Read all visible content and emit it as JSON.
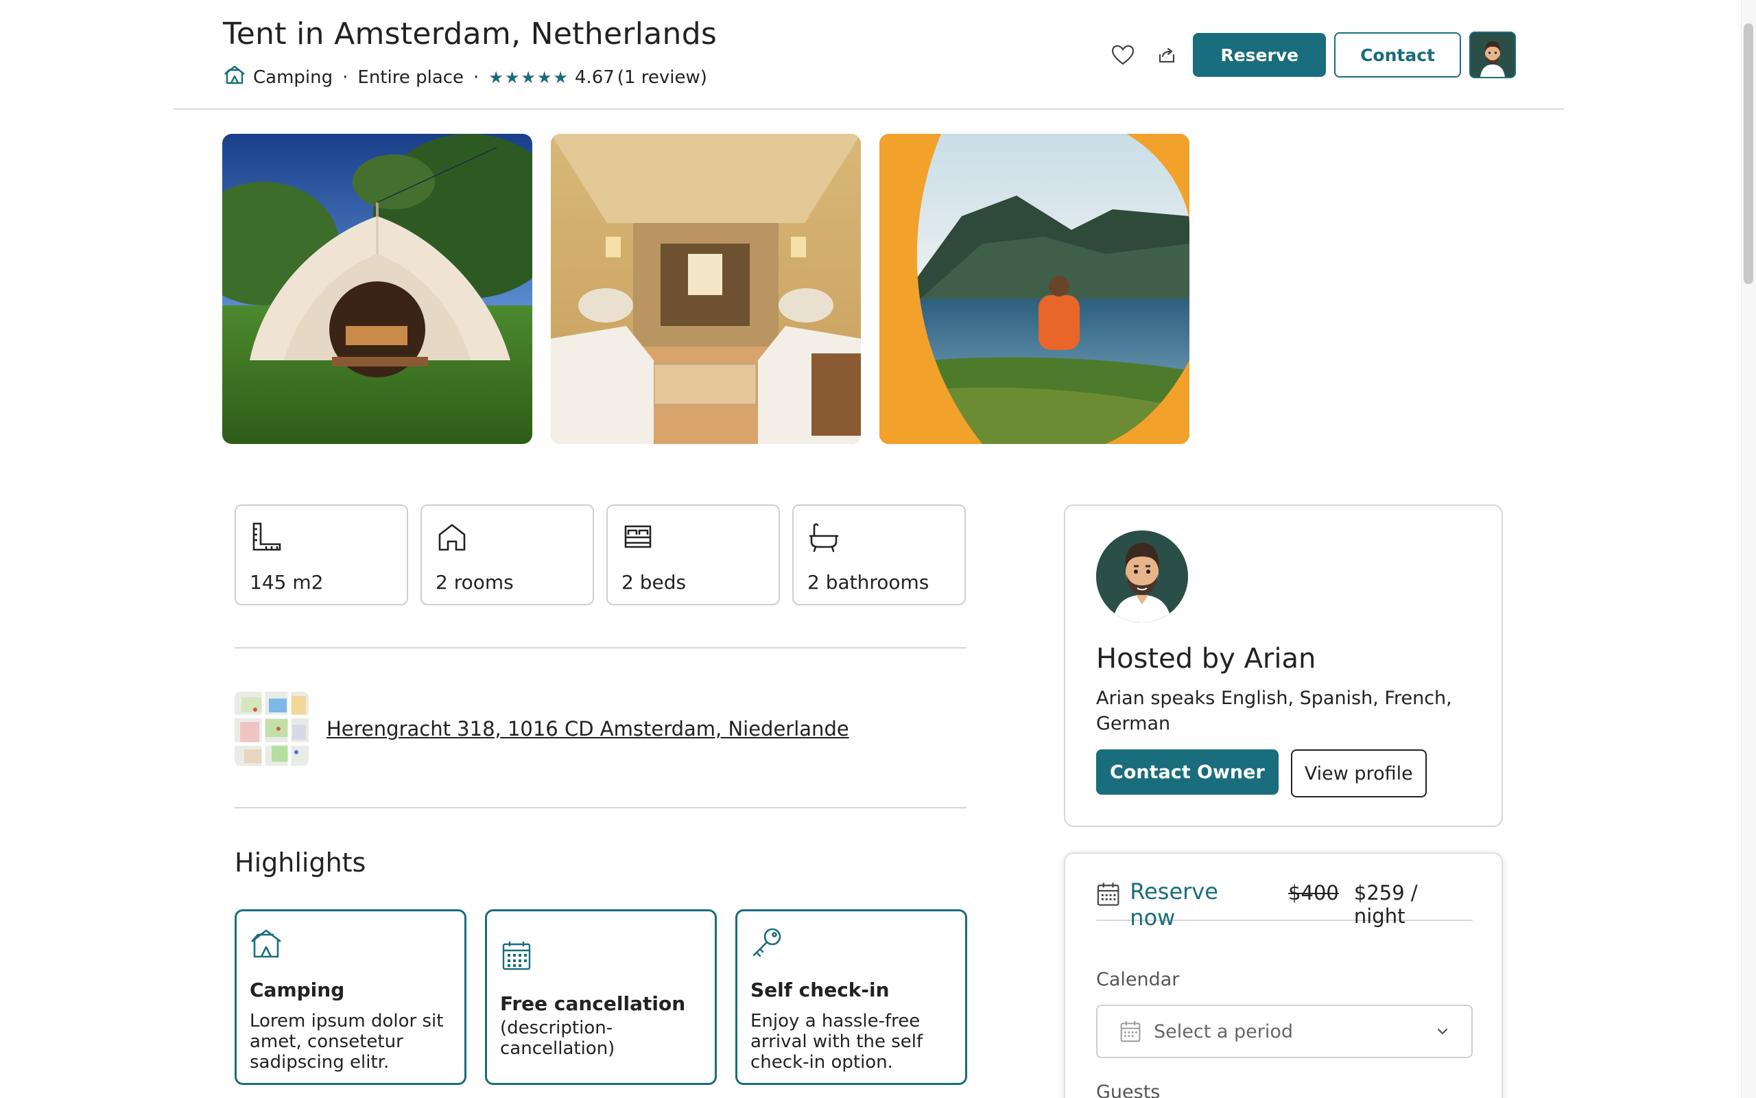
{
  "header": {
    "title": "Tent in Amsterdam, Netherlands",
    "category": "Camping",
    "type": "Entire place",
    "rating": "4.67",
    "reviews": "(1 review)",
    "reserve_label": "Reserve",
    "contact_label": "Contact"
  },
  "gallery": {
    "photos": [
      "tent-exterior",
      "tent-interior",
      "lake-view"
    ]
  },
  "stats": [
    {
      "icon": "ruler-icon",
      "label": "145 m2"
    },
    {
      "icon": "house-icon",
      "label": "2 rooms"
    },
    {
      "icon": "bed-icon",
      "label": "2 beds"
    },
    {
      "icon": "bathtub-icon",
      "label": "2 bathrooms"
    }
  ],
  "address": {
    "text": "Herengracht 318, 1016 CD Amsterdam, Niederlande"
  },
  "highlights": {
    "title": "Highlights",
    "items": [
      {
        "icon": "camping-house-icon",
        "title": "Camping",
        "desc": "Lorem ipsum dolor sit amet, consetetur sadipscing elitr."
      },
      {
        "icon": "calendar-icon",
        "title": "Free cancellation",
        "desc": "(description-cancellation)"
      },
      {
        "icon": "key-icon",
        "title": "Self check-in",
        "desc": "Enjoy a hassle-free arrival with the self check-in option."
      }
    ]
  },
  "host": {
    "name": "Hosted by Arian",
    "languages": "Arian speaks English, Spanish, French, German",
    "contact_owner_label": "Contact Owner",
    "view_profile_label": "View profile"
  },
  "reserve": {
    "reserve_now_label": "Reserve now",
    "old_price": "$400",
    "price": "$259 / night",
    "calendar_label": "Calendar",
    "period_placeholder": "Select a period",
    "guests_label": "Guests"
  },
  "colors": {
    "accent": "#196d7c",
    "border": "#cfcfcf",
    "text": "#222222"
  }
}
